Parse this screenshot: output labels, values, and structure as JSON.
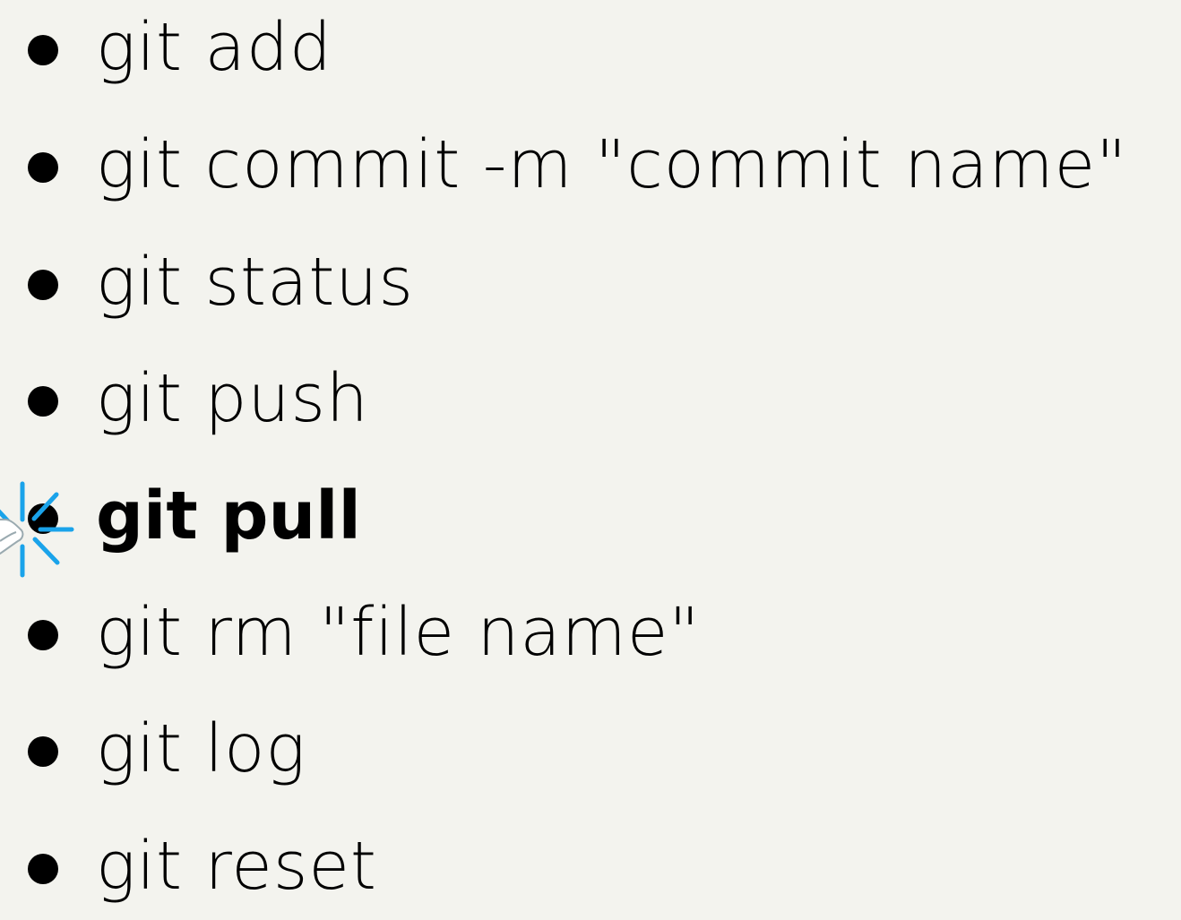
{
  "commands": [
    {
      "label": "git add",
      "active": false
    },
    {
      "label": "git commit -m \"commit name\"",
      "active": false
    },
    {
      "label": "git status",
      "active": false
    },
    {
      "label": "git push",
      "active": false
    },
    {
      "label": "git pull",
      "active": true
    },
    {
      "label": "git rm \"file name\"",
      "active": false
    },
    {
      "label": "git log",
      "active": false
    },
    {
      "label": "git reset",
      "active": false
    }
  ],
  "theme": {
    "background": "#f3f3ee",
    "text": "#000000",
    "click_accent": "#1aa3ea"
  },
  "icons": {
    "cursor": "pointer-click-icon"
  }
}
